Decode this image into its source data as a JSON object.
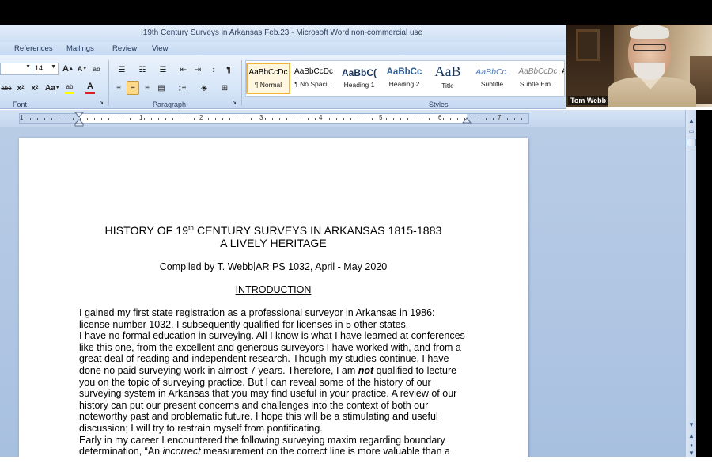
{
  "window": {
    "title": "I19th Century Surveys in Arkansas Feb.23 - Microsoft Word non-commercial use"
  },
  "ribbon_tabs": [
    "References",
    "Mailings",
    "Review",
    "View"
  ],
  "font_group": {
    "font_size": "14",
    "label": "Font",
    "buttons": {
      "grow": "A",
      "shrink": "A",
      "clear_format": "ab",
      "strike": "abe",
      "subscript": "x",
      "superscript": "x",
      "change_case": "Aa",
      "highlight": "ab",
      "font_color": "A"
    },
    "highlight_color": "#ffff00",
    "font_color_color": "#e02020"
  },
  "paragraph_group": {
    "label": "Paragraph",
    "pilcrow": "¶"
  },
  "styles_group": {
    "label": "Styles",
    "items": [
      {
        "sample": "AaBbCcDc",
        "name": "¶ Normal",
        "selected": true
      },
      {
        "sample": "AaBbCcDc",
        "name": "¶ No Spaci..."
      },
      {
        "sample": "AaBbC(",
        "name": "Heading 1"
      },
      {
        "sample": "AaBbCc",
        "name": "Heading 2"
      },
      {
        "sample": "AaB",
        "name": "Title"
      },
      {
        "sample": "AaBbCc.",
        "name": "Subtitle"
      },
      {
        "sample": "AaBbCcDc",
        "name": "Subtle Em..."
      },
      {
        "sample": "A",
        "name": ""
      }
    ]
  },
  "ruler": {
    "numbers": [
      "1",
      "1",
      "2",
      "3",
      "4",
      "5",
      "6",
      "7"
    ]
  },
  "document": {
    "title_line1_pre": "HISTORY OF 19",
    "title_line1_sup": "th",
    "title_line1_post": " CENTURY SURVEYS IN ARKANSAS 1815-1883",
    "title_line2": "A LIVELY HERITAGE",
    "byline_pre": "Compiled by T. Webb",
    "byline_post": "AR PS 1032, April - May 2020",
    "heading": "INTRODUCTION",
    "p1": "I gained my first state registration as a professional surveyor in Arkansas in 1986: license number 1032. I subsequently qualified for licenses in 5 other states.",
    "p2_pre": "I have no formal education in surveying. All I know is what I have learned at conferences like this one, from the excellent and generous surveyors I have worked with, and from a great deal of reading and independent research. Though my studies continue, I have done no paid surveying work in almost 7 years. Therefore, I am ",
    "p2_emph": "not",
    "p2_post": " qualified to lecture you on the topic of surveying practice. But I can reveal some of the history of our surveying system in Arkansas that you may find useful in your practice. A review of our history can put our present concerns and challenges into the context of both our noteworthy past and problematic future. I hope this will be a stimulating and useful discussion; I will try to restrain myself from pontificating.",
    "p3_pre": "Early in my career I encountered the following surveying maxim regarding boundary determination, “An ",
    "p3_emph": "incorrect",
    "p3_post": " measurement on the correct line is more valuable than a"
  },
  "video": {
    "participant_name": "Tom Webb"
  },
  "scrollbar": {
    "up": "▲",
    "down": "▼",
    "prev_page": "▲",
    "next_page": "▼",
    "select_browse": "●"
  }
}
